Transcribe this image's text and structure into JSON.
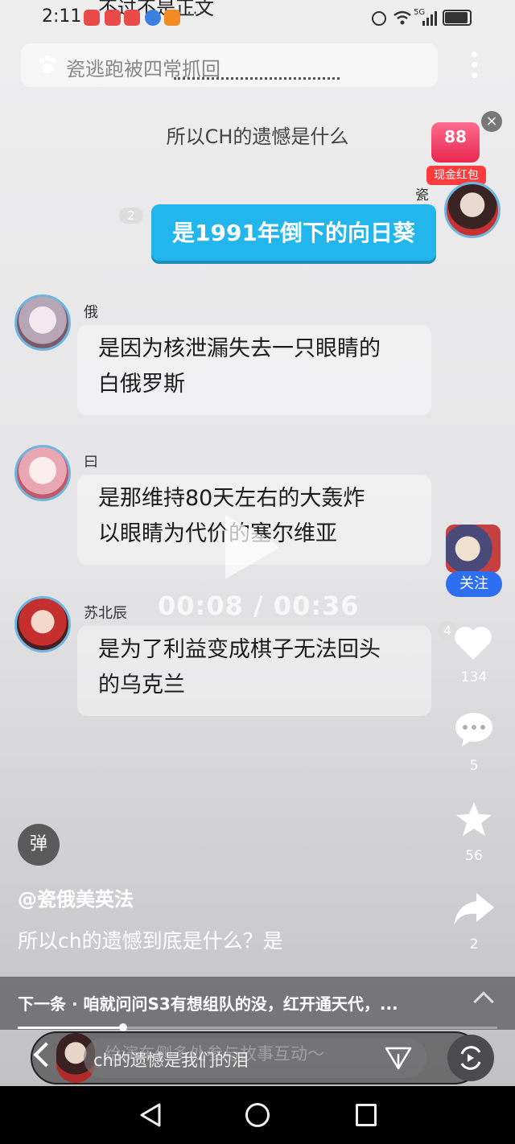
{
  "status_bar": {
    "time": "2:11",
    "overflow": "···",
    "cut_top_text": "不过不是正文",
    "network": "5G",
    "icons": [
      "notification-app-icon",
      "notification-app-icon",
      "notification-app-icon",
      "browser-icon",
      "video-app-icon",
      "data-saver-icon",
      "wifi-icon",
      "signal-icon",
      "battery-icon"
    ]
  },
  "search": {
    "placeholder": "瓷逃跑被四常抓回",
    "icon": "paw-icon"
  },
  "chat": {
    "title": "所以CH的遗憾是什么",
    "red_packet": {
      "amount": "88",
      "label": "现金红包"
    },
    "outgoing": {
      "sender": "瓷",
      "read_count": "2",
      "text": "是1991年倒下的向日葵"
    },
    "messages": [
      {
        "sender": "俄",
        "lines": [
          "是因为核泄漏失去一只眼睛的",
          "白俄罗斯"
        ]
      },
      {
        "sender": "曰",
        "lines": [
          "是那维持80天左右的大轰炸",
          "以眼睛为代价的塞尔维亚"
        ]
      },
      {
        "sender": "苏北辰",
        "lines": [
          "是为了利益变成棋子无法回头",
          "的乌克兰"
        ]
      }
    ],
    "side_badge": "4"
  },
  "player": {
    "timestamp": "00:08 / 00:36",
    "progress": 0.22
  },
  "rail": {
    "follow_label": "关注",
    "likes": "134",
    "comments": "5",
    "favorites": "56",
    "shares": "2"
  },
  "info": {
    "danmaku_label": "弹",
    "author": "@瓷俄美英法",
    "caption": "所以ch的遗憾到底是什么？是"
  },
  "next": {
    "text": "下一条 · 咱就问问S3有想组队的没，红开通天代，..."
  },
  "input": {
    "text": "ch的遗憾是我们的泪",
    "ghost_text": "给演车侧多处参与故事互动～"
  },
  "colors": {
    "bubble_blue": "#23b6ec",
    "follow_blue": "#2d6ff0",
    "avatar_ring": "#6fb6df"
  }
}
